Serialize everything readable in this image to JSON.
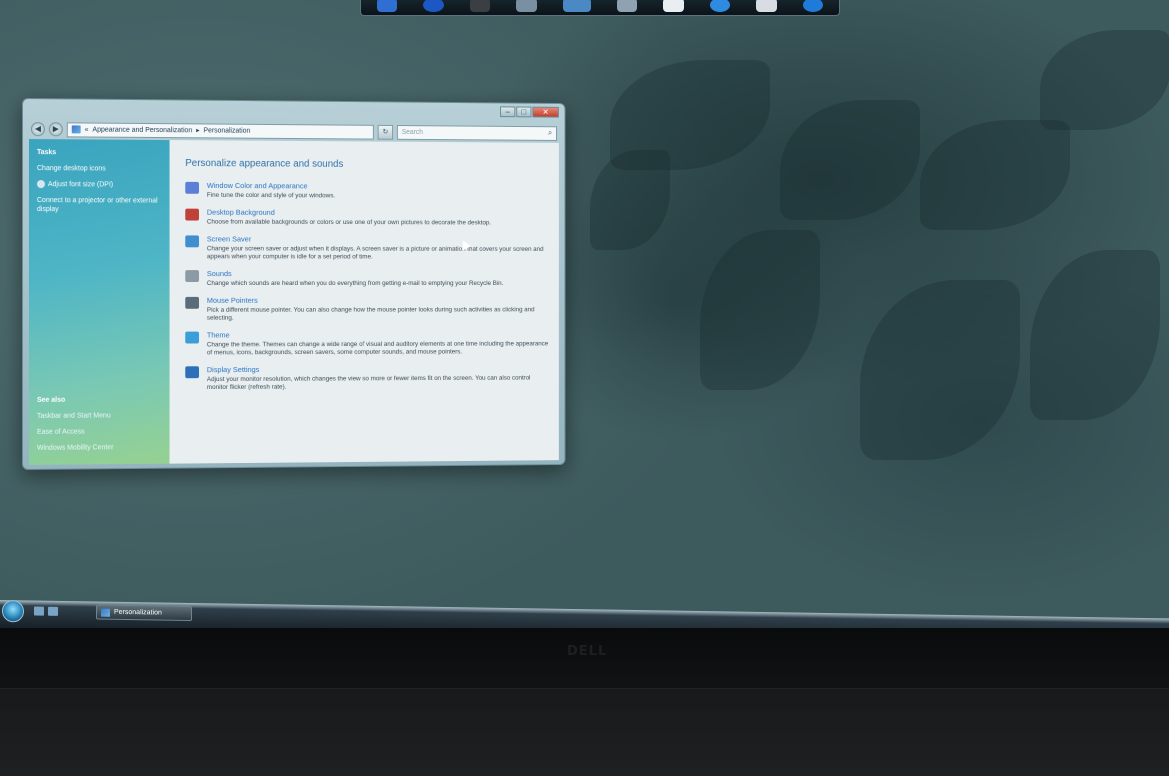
{
  "window": {
    "breadcrumb": [
      "Appearance and Personalization",
      "Personalization"
    ],
    "search_placeholder": "Search",
    "tasks_heading": "Tasks",
    "tasks": [
      "Change desktop icons",
      "Adjust font size (DPI)",
      "Connect to a projector or other external display"
    ],
    "see_also_heading": "See also",
    "see_also": [
      "Taskbar and Start Menu",
      "Ease of Access",
      "Windows Mobility Center"
    ],
    "content_title": "Personalize appearance and sounds",
    "options": [
      {
        "icon": "window-color-icon",
        "color": "#5b7fd6",
        "title": "Window Color and Appearance",
        "desc": "Fine tune the color and style of your windows."
      },
      {
        "icon": "desktop-background-icon",
        "color": "#c0413a",
        "title": "Desktop Background",
        "desc": "Choose from available backgrounds or colors or use one of your own pictures to decorate the desktop."
      },
      {
        "icon": "screen-saver-icon",
        "color": "#3f8fd0",
        "title": "Screen Saver",
        "desc": "Change your screen saver or adjust when it displays. A screen saver is a picture or animation that covers your screen and appears when your computer is idle for a set period of time."
      },
      {
        "icon": "sounds-icon",
        "color": "#8c9aa6",
        "title": "Sounds",
        "desc": "Change which sounds are heard when you do everything from getting e-mail to emptying your Recycle Bin."
      },
      {
        "icon": "mouse-pointer-icon",
        "color": "#5a6c7a",
        "title": "Mouse Pointers",
        "desc": "Pick a different mouse pointer. You can also change how the mouse pointer looks during such activities as clicking and selecting."
      },
      {
        "icon": "theme-icon",
        "color": "#3a9ed8",
        "title": "Theme",
        "desc": "Change the theme. Themes can change a wide range of visual and auditory elements at one time including the appearance of menus, icons, backgrounds, screen savers, some computer sounds, and mouse pointers."
      },
      {
        "icon": "display-settings-icon",
        "color": "#2d6fb8",
        "title": "Display Settings",
        "desc": "Adjust your monitor resolution, which changes the view so more or fewer items fit on the screen. You can also control monitor flicker (refresh rate)."
      }
    ]
  },
  "taskbar": {
    "active_task": "Personalization"
  },
  "monitor": {
    "brand": "DELL"
  }
}
